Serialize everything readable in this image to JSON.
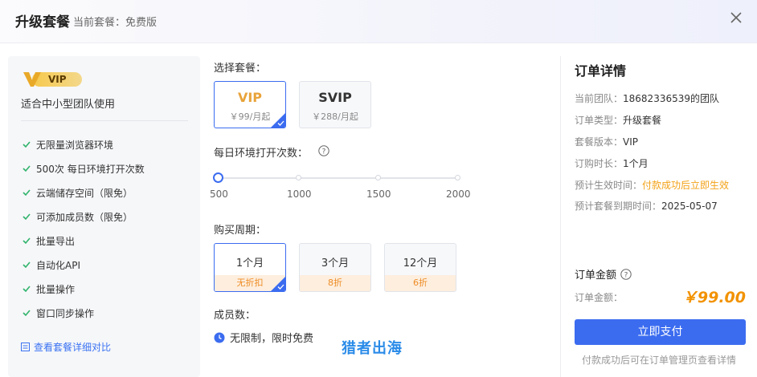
{
  "header": {
    "title": "升级套餐",
    "current_plan": "当前套餐：免费版",
    "close_icon": "close-icon"
  },
  "left_panel": {
    "badge": "VIP",
    "description": "适合中小型团队使用",
    "features": [
      "无限量浏览器环境",
      "500次 每日环境打开次数",
      "云端储存空间（限免）",
      "可添加成员数（限免）",
      "批量导出",
      "自动化API",
      "批量操作",
      "窗口同步操作"
    ],
    "compare_link": "查看套餐详细对比"
  },
  "plan_select": {
    "label": "选择套餐：",
    "options": [
      {
        "name": "VIP",
        "price": "￥99/月起",
        "selected": true
      },
      {
        "name": "SVIP",
        "price": "￥288/月起",
        "selected": false
      }
    ]
  },
  "daily_opens": {
    "label": "每日环境打开次数：",
    "ticks": [
      "500",
      "1000",
      "1500",
      "2000"
    ],
    "value": 500
  },
  "period": {
    "label": "购买周期：",
    "options": [
      {
        "name": "1个月",
        "discount": "无折扣",
        "selected": true
      },
      {
        "name": "3个月",
        "discount": "8折",
        "selected": false
      },
      {
        "name": "12个月",
        "discount": "6折",
        "selected": false
      }
    ]
  },
  "members": {
    "label": "成员数：",
    "value": "无限制，限时免费"
  },
  "watermark": "猎者出海",
  "order": {
    "title": "订单详情",
    "rows": [
      {
        "label": "当前团队：",
        "value": "18682336539的团队"
      },
      {
        "label": "订单类型：",
        "value": "升级套餐"
      },
      {
        "label": "套餐版本：",
        "value": "VIP"
      },
      {
        "label": "订购时长：",
        "value": "1个月"
      },
      {
        "label": "预计生效时间：",
        "value": "付款成功后立即生效"
      },
      {
        "label": "预计套餐到期时间：",
        "value": "2025-05-07"
      }
    ],
    "amount_title": "订单金额",
    "amount_label": "订单金额：",
    "amount_value": "￥99.00",
    "pay_button": "立即支付",
    "pay_note": "付款成功后可在订单管理页查看详情"
  },
  "colors": {
    "accent": "#3b6cf0",
    "price_orange": "#f29200",
    "discount_orange": "#ee8c24",
    "vip_gold": "#f7c94d"
  }
}
